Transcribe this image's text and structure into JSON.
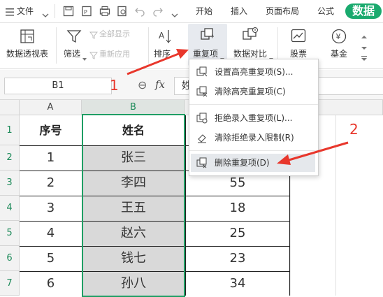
{
  "menubar": {
    "file_label": "文件",
    "tabs": [
      "开始",
      "插入",
      "页面布局",
      "公式",
      "数据"
    ],
    "active_tab": "数据"
  },
  "ribbon": {
    "pivot": "数据透视表",
    "filter": "筛选",
    "show_all": "全部显示",
    "reapply": "重新应用",
    "sort": "排序",
    "duplicates": "重复项",
    "compare": "数据对比",
    "stocks": "股票",
    "funds": "基金"
  },
  "formula_bar": {
    "cell_ref": "B1",
    "zoom_glyph": "⊖",
    "fx_label": "fx",
    "content_preview": "姓"
  },
  "dropdown": {
    "items": [
      "设置高亮重复项(S)...",
      "清除高亮重复项(C)",
      "拒绝录入重复项(L)...",
      "清除拒绝录入限制(R)",
      "删除重复项(D)"
    ]
  },
  "annotations": {
    "step1": "1",
    "step2": "2"
  },
  "sheet": {
    "columns": [
      "A",
      "B"
    ],
    "row_numbers": [
      "1",
      "2",
      "3",
      "4",
      "5",
      "6",
      "7"
    ],
    "header_row": {
      "a": "序号",
      "b": "姓名"
    },
    "rows": [
      {
        "a": "1",
        "b": "张三",
        "c": ""
      },
      {
        "a": "2",
        "b": "李四",
        "c": "55"
      },
      {
        "a": "3",
        "b": "王五",
        "c": "18"
      },
      {
        "a": "4",
        "b": "赵六",
        "c": "25"
      },
      {
        "a": "5",
        "b": "钱七",
        "c": "23"
      },
      {
        "a": "6",
        "b": "孙八",
        "c": "34"
      }
    ]
  },
  "colors": {
    "accent": "#1aaa6e",
    "arrow": "#e8372c",
    "selection_border": "#1f9e64",
    "selected_fill": "#d9d9d9"
  }
}
